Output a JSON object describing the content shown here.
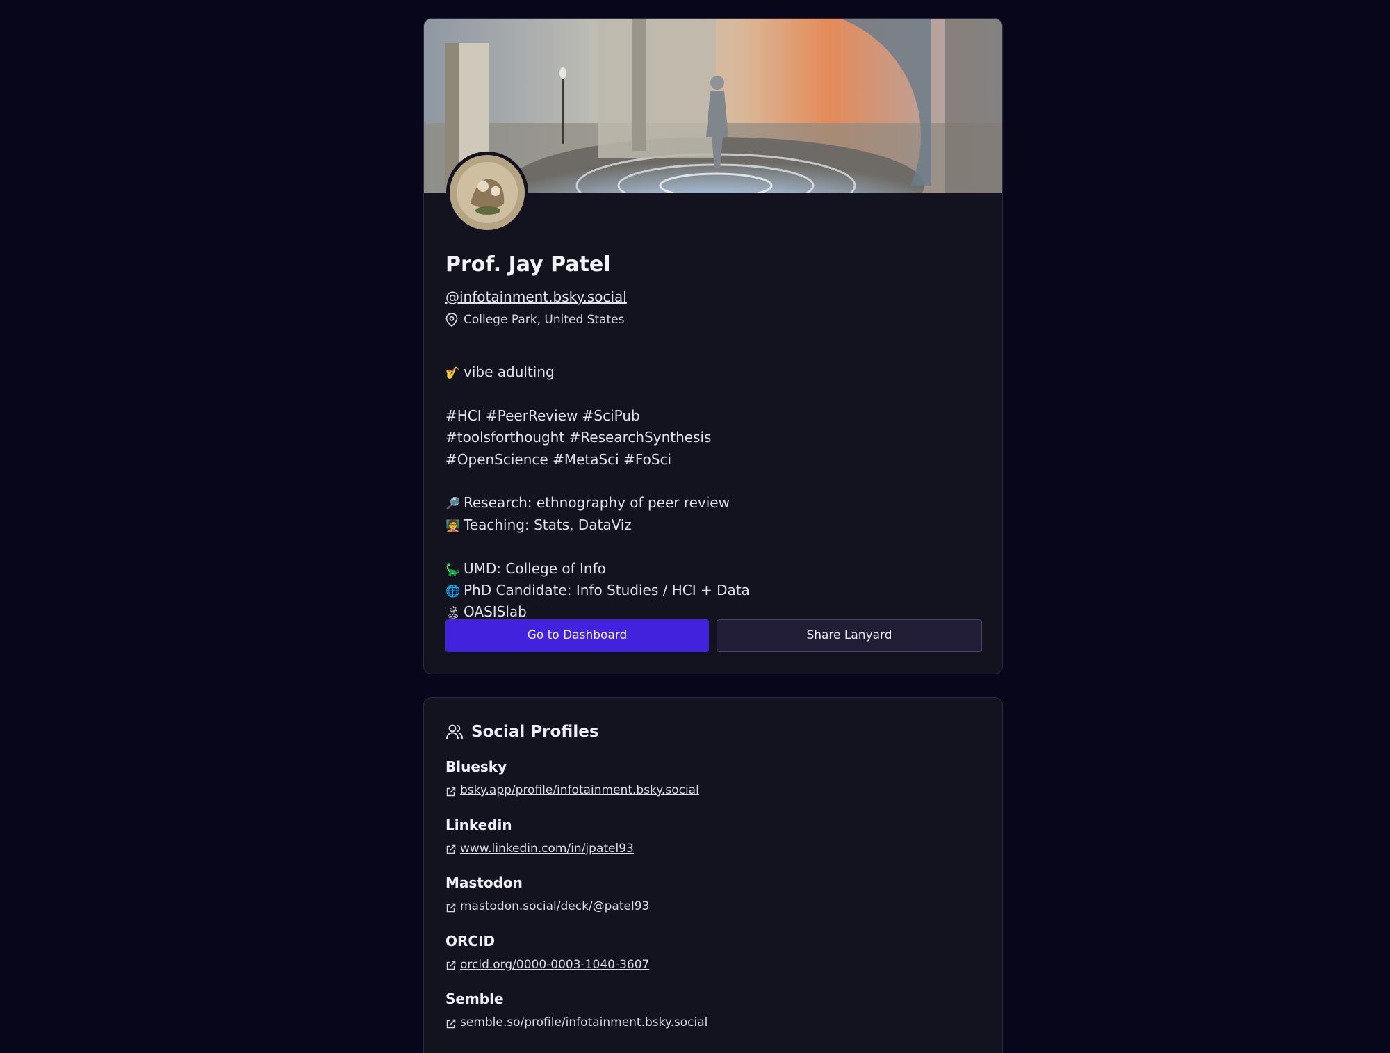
{
  "profile": {
    "name": "Prof. Jay Patel",
    "handle": "@infotainment.bsky.social",
    "location": "College Park, United States",
    "bio_lines": [
      {
        "emoji": "🎷",
        "text": "vibe adulting"
      },
      {
        "emoji": "",
        "text": ""
      },
      {
        "emoji": "",
        "text": "#HCI #PeerReview #SciPub"
      },
      {
        "emoji": "",
        "text": "#toolsforthought #ResearchSynthesis"
      },
      {
        "emoji": "",
        "text": "#OpenScience #MetaSci #FoSci"
      },
      {
        "emoji": "",
        "text": ""
      },
      {
        "emoji": "🔎",
        "text": "Research: ethnography of peer review"
      },
      {
        "emoji": "🧑‍🏫",
        "text": "Teaching: Stats, DataViz"
      },
      {
        "emoji": "",
        "text": ""
      },
      {
        "emoji": "🦕",
        "text": "UMD: College of Info"
      },
      {
        "emoji": "🌐",
        "text": "PhD Candidate: Info Studies / HCI + Data"
      },
      {
        "emoji": "🏝",
        "text": "OASISlab"
      }
    ]
  },
  "actions": {
    "primary_label": "Go to Dashboard",
    "secondary_label": "Share Lanyard"
  },
  "social": {
    "title": "Social Profiles",
    "items": [
      {
        "name": "Bluesky",
        "url": "bsky.app/profile/infotainment.bsky.social"
      },
      {
        "name": "Linkedin",
        "url": "www.linkedin.com/in/jpatel93"
      },
      {
        "name": "Mastodon",
        "url": "mastodon.social/deck/@patel93"
      },
      {
        "name": "ORCID",
        "url": "orcid.org/0000-0003-1040-3607"
      },
      {
        "name": "Semble",
        "url": "semble.so/profile/infotainment.bsky.social"
      }
    ]
  },
  "icons": {
    "location": "map-pin-icon",
    "social_title": "users-icon",
    "link": "external-link-icon"
  },
  "colors": {
    "background": "#07061a",
    "card": "#13121f",
    "primary_button": "#4322dd",
    "secondary_button": "#221d36"
  }
}
